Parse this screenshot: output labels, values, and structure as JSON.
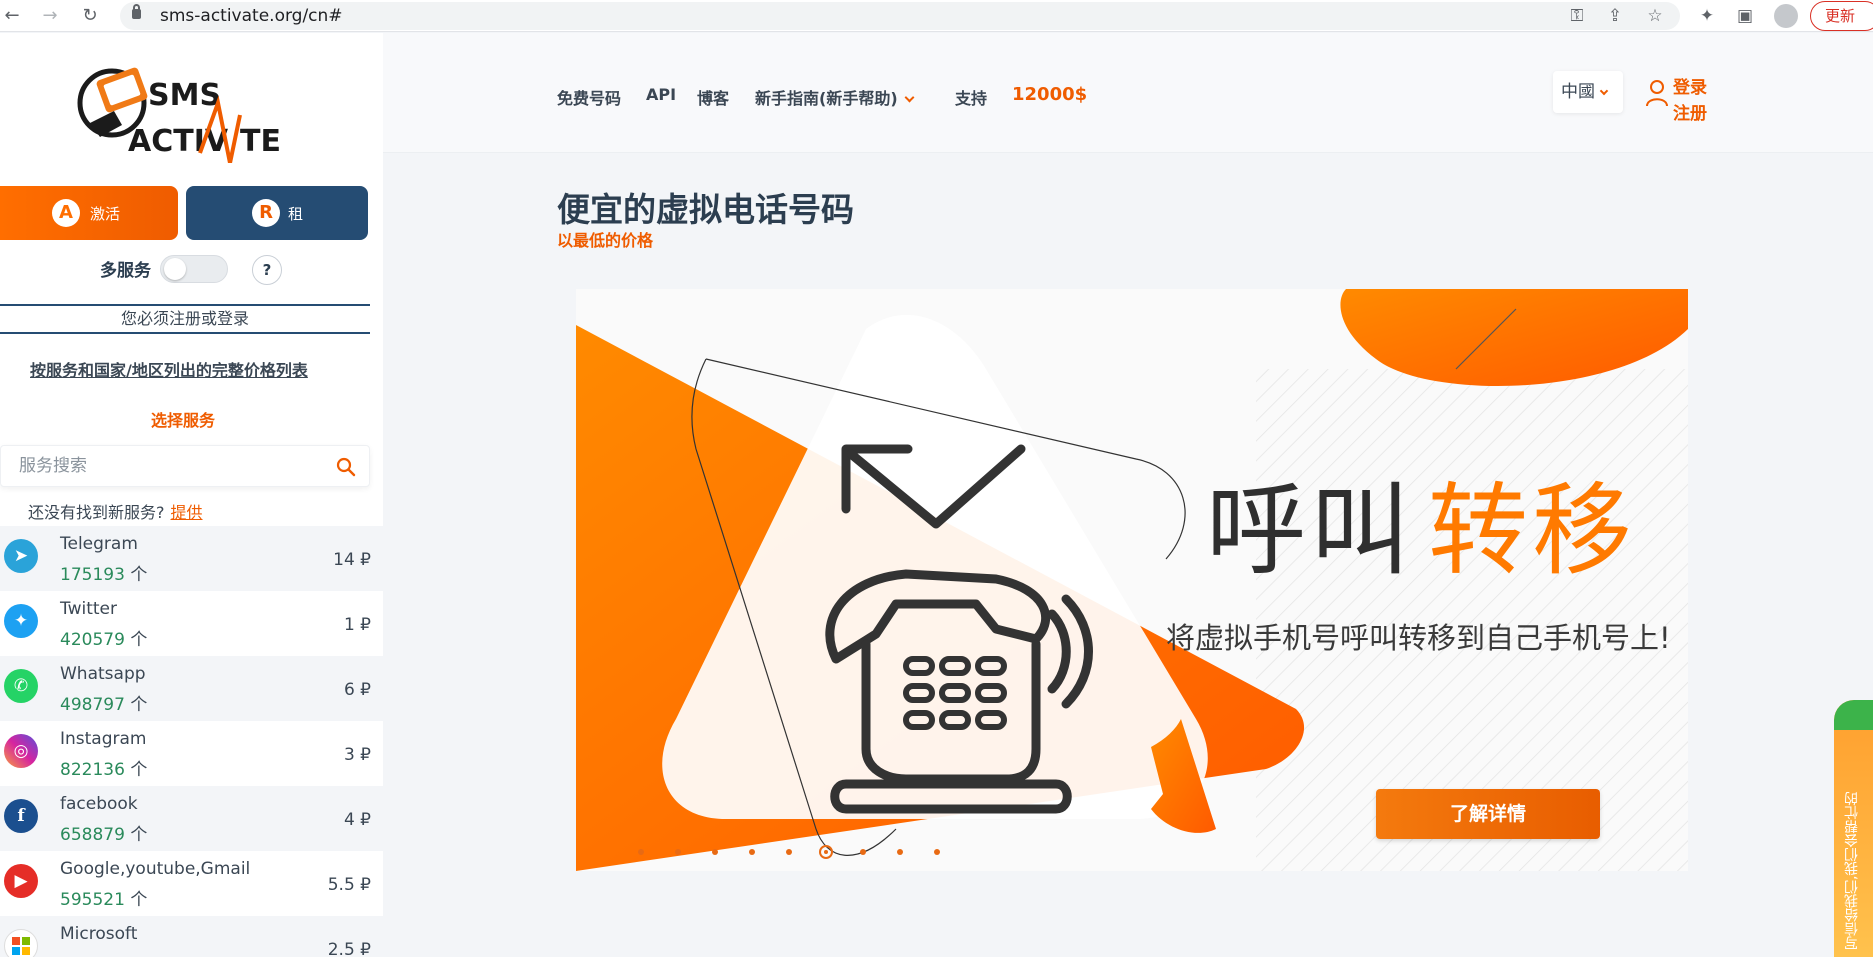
{
  "browser": {
    "url": "sms-activate.org/cn#",
    "update_label": "更新"
  },
  "sidebar": {
    "activate_label": "激活",
    "rent_label": "租",
    "multi_service_label": "多服务",
    "help_label": "?",
    "login_notice": "您必须注册或登录",
    "price_list_link": "按服务和国家/地区列出的完整价格列表",
    "choose_service": "选择服务",
    "search_placeholder": "服务搜索",
    "suggest_text": "还没有找到新服务?",
    "suggest_link": "提供",
    "unit": "个",
    "services": [
      {
        "name": "Telegram",
        "count": "175193",
        "price": "14 ₽",
        "icon": "telegram-icon",
        "color": "#2aa3d9"
      },
      {
        "name": "Twitter",
        "count": "420579",
        "price": "1 ₽",
        "icon": "twitter-icon",
        "color": "#1da1f2"
      },
      {
        "name": "Whatsapp",
        "count": "498797",
        "price": "6 ₽",
        "icon": "whatsapp-icon",
        "color": "#25d366"
      },
      {
        "name": "Instagram",
        "count": "822136",
        "price": "3 ₽",
        "icon": "instagram-icon",
        "color": "#d6249f"
      },
      {
        "name": "facebook",
        "count": "658879",
        "price": "4 ₽",
        "icon": "facebook-icon",
        "color": "#1b4f8f"
      },
      {
        "name": "Google,youtube,Gmail",
        "count": "595521",
        "price": "5.5 ₽",
        "icon": "google-icon",
        "color": "#e52d27"
      },
      {
        "name": "Microsoft",
        "count": "",
        "price": "2.5 ₽",
        "icon": "microsoft-icon",
        "color": "#ffffff"
      }
    ]
  },
  "header": {
    "nav": [
      "免费号码",
      "API",
      "博客",
      "新手指南(新手帮助)",
      "支持",
      "12000$"
    ],
    "language": "中國",
    "login": "登录",
    "register": "注册"
  },
  "main": {
    "title": "便宜的虚拟电话号码",
    "subtitle": "以最低的价格"
  },
  "banner": {
    "title_dark": "呼叫",
    "title_orange": "转移",
    "subtitle": "将虚拟手机号呼叫转移到自己手机号上!",
    "cta": "了解详情",
    "slide_count": 9,
    "active_slide": 6,
    "accent_color": "#ff7a00"
  },
  "feedback": {
    "label": "写信给我们,我们会帮忙的"
  }
}
